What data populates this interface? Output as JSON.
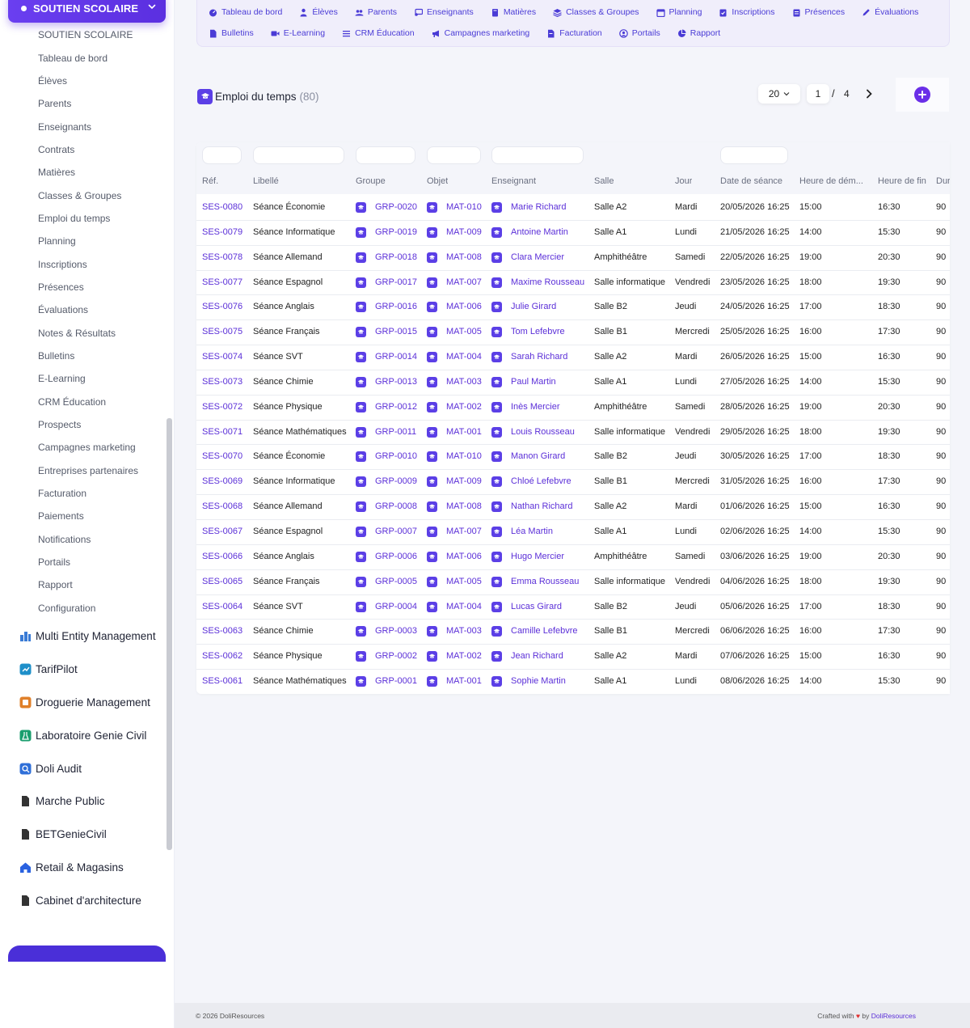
{
  "sidebar": {
    "module_title": "SOUTIEN SCOLAIRE",
    "submenu": [
      "SOUTIEN SCOLAIRE",
      "Tableau de bord",
      "Élèves",
      "Parents",
      "Enseignants",
      "Contrats",
      "Matières",
      "Classes & Groupes",
      "Emploi du temps",
      "Planning",
      "Inscriptions",
      "Présences",
      "Évaluations",
      "Notes & Résultats",
      "Bulletins",
      "E-Learning",
      "CRM Éducation",
      "Prospects",
      "Campagnes marketing",
      "Entreprises partenaires",
      "Facturation",
      "Paiements",
      "Notifications",
      "Portails",
      "Rapport",
      "Configuration"
    ],
    "modules": [
      {
        "label": "Multi Entity Management",
        "icon": "buildings-icon",
        "color": "#3a7bd5"
      },
      {
        "label": "TarifPilot",
        "icon": "tarif-icon",
        "color": "#1e8fc9"
      },
      {
        "label": "Droguerie Management",
        "icon": "droguerie-icon",
        "color": "#e0802a"
      },
      {
        "label": "Laboratoire Genie Civil",
        "icon": "lab-icon",
        "color": "#1a9e6e"
      },
      {
        "label": "Doli Audit",
        "icon": "audit-icon",
        "color": "#2f6fd8"
      },
      {
        "label": "Marche Public",
        "icon": "file-icon",
        "color": "#333333"
      },
      {
        "label": "BETGenieCivil",
        "icon": "file-icon",
        "color": "#333333"
      },
      {
        "label": "Retail & Magasins",
        "icon": "home-icon",
        "color": "#2a62e0"
      },
      {
        "label": "Cabinet d'architecture",
        "icon": "file-icon",
        "color": "#333333"
      }
    ]
  },
  "topnav": {
    "row1": [
      {
        "label": "Tableau de bord",
        "icon": "dashboard-icon"
      },
      {
        "label": "Élèves",
        "icon": "student-icon"
      },
      {
        "label": "Parents",
        "icon": "users-icon"
      },
      {
        "label": "Enseignants",
        "icon": "teacher-icon"
      },
      {
        "label": "Matières",
        "icon": "book-icon"
      },
      {
        "label": "Classes & Groupes",
        "icon": "layers-icon"
      },
      {
        "label": "Planning",
        "icon": "calendar-icon"
      },
      {
        "label": "Inscriptions",
        "icon": "clipboard-check-icon"
      },
      {
        "label": "Présences",
        "icon": "clipboard-icon"
      },
      {
        "label": "Évaluations",
        "icon": "pencil-icon"
      }
    ],
    "row2": [
      {
        "label": "Bulletins",
        "icon": "document-icon"
      },
      {
        "label": "E-Learning",
        "icon": "video-icon"
      },
      {
        "label": "CRM Éducation",
        "icon": "list-icon"
      },
      {
        "label": "Campagnes marketing",
        "icon": "megaphone-icon"
      },
      {
        "label": "Facturation",
        "icon": "invoice-icon"
      },
      {
        "label": "Portails",
        "icon": "user-circle-icon"
      },
      {
        "label": "Rapport",
        "icon": "pie-chart-icon"
      }
    ]
  },
  "page": {
    "title": "Emploi du temps",
    "count": "(80)",
    "page_size": "20",
    "current_page": "1",
    "separator": "/",
    "total_pages": "4"
  },
  "table": {
    "headers": [
      "Réf.",
      "Libellé",
      "Groupe",
      "Objet",
      "Enseignant",
      "Salle",
      "Jour",
      "Date de séance",
      "Heure de dém...",
      "Heure de fin",
      "Dur"
    ],
    "rows": [
      [
        "SES-0080",
        "Séance Économie",
        "GRP-0020",
        "MAT-010",
        "Marie Richard",
        "Salle A2",
        "Mardi",
        "20/05/2026 16:25",
        "15:00",
        "16:30",
        "90"
      ],
      [
        "SES-0079",
        "Séance Informatique",
        "GRP-0019",
        "MAT-009",
        "Antoine Martin",
        "Salle A1",
        "Lundi",
        "21/05/2026 16:25",
        "14:00",
        "15:30",
        "90"
      ],
      [
        "SES-0078",
        "Séance Allemand",
        "GRP-0018",
        "MAT-008",
        "Clara Mercier",
        "Amphithéâtre",
        "Samedi",
        "22/05/2026 16:25",
        "19:00",
        "20:30",
        "90"
      ],
      [
        "SES-0077",
        "Séance Espagnol",
        "GRP-0017",
        "MAT-007",
        "Maxime Rousseau",
        "Salle informatique",
        "Vendredi",
        "23/05/2026 16:25",
        "18:00",
        "19:30",
        "90"
      ],
      [
        "SES-0076",
        "Séance Anglais",
        "GRP-0016",
        "MAT-006",
        "Julie Girard",
        "Salle B2",
        "Jeudi",
        "24/05/2026 16:25",
        "17:00",
        "18:30",
        "90"
      ],
      [
        "SES-0075",
        "Séance Français",
        "GRP-0015",
        "MAT-005",
        "Tom Lefebvre",
        "Salle B1",
        "Mercredi",
        "25/05/2026 16:25",
        "16:00",
        "17:30",
        "90"
      ],
      [
        "SES-0074",
        "Séance SVT",
        "GRP-0014",
        "MAT-004",
        "Sarah Richard",
        "Salle A2",
        "Mardi",
        "26/05/2026 16:25",
        "15:00",
        "16:30",
        "90"
      ],
      [
        "SES-0073",
        "Séance Chimie",
        "GRP-0013",
        "MAT-003",
        "Paul Martin",
        "Salle A1",
        "Lundi",
        "27/05/2026 16:25",
        "14:00",
        "15:30",
        "90"
      ],
      [
        "SES-0072",
        "Séance Physique",
        "GRP-0012",
        "MAT-002",
        "Inès Mercier",
        "Amphithéâtre",
        "Samedi",
        "28/05/2026 16:25",
        "19:00",
        "20:30",
        "90"
      ],
      [
        "SES-0071",
        "Séance Mathématiques",
        "GRP-0011",
        "MAT-001",
        "Louis Rousseau",
        "Salle informatique",
        "Vendredi",
        "29/05/2026 16:25",
        "18:00",
        "19:30",
        "90"
      ],
      [
        "SES-0070",
        "Séance Économie",
        "GRP-0010",
        "MAT-010",
        "Manon Girard",
        "Salle B2",
        "Jeudi",
        "30/05/2026 16:25",
        "17:00",
        "18:30",
        "90"
      ],
      [
        "SES-0069",
        "Séance Informatique",
        "GRP-0009",
        "MAT-009",
        "Chloé Lefebvre",
        "Salle B1",
        "Mercredi",
        "31/05/2026 16:25",
        "16:00",
        "17:30",
        "90"
      ],
      [
        "SES-0068",
        "Séance Allemand",
        "GRP-0008",
        "MAT-008",
        "Nathan Richard",
        "Salle A2",
        "Mardi",
        "01/06/2026 16:25",
        "15:00",
        "16:30",
        "90"
      ],
      [
        "SES-0067",
        "Séance Espagnol",
        "GRP-0007",
        "MAT-007",
        "Léa Martin",
        "Salle A1",
        "Lundi",
        "02/06/2026 16:25",
        "14:00",
        "15:30",
        "90"
      ],
      [
        "SES-0066",
        "Séance Anglais",
        "GRP-0006",
        "MAT-006",
        "Hugo Mercier",
        "Amphithéâtre",
        "Samedi",
        "03/06/2026 16:25",
        "19:00",
        "20:30",
        "90"
      ],
      [
        "SES-0065",
        "Séance Français",
        "GRP-0005",
        "MAT-005",
        "Emma Rousseau",
        "Salle informatique",
        "Vendredi",
        "04/06/2026 16:25",
        "18:00",
        "19:30",
        "90"
      ],
      [
        "SES-0064",
        "Séance SVT",
        "GRP-0004",
        "MAT-004",
        "Lucas Girard",
        "Salle B2",
        "Jeudi",
        "05/06/2026 16:25",
        "17:00",
        "18:30",
        "90"
      ],
      [
        "SES-0063",
        "Séance Chimie",
        "GRP-0003",
        "MAT-003",
        "Camille Lefebvre",
        "Salle B1",
        "Mercredi",
        "06/06/2026 16:25",
        "16:00",
        "17:30",
        "90"
      ],
      [
        "SES-0062",
        "Séance Physique",
        "GRP-0002",
        "MAT-002",
        "Jean Richard",
        "Salle A2",
        "Mardi",
        "07/06/2026 16:25",
        "15:00",
        "16:30",
        "90"
      ],
      [
        "SES-0061",
        "Séance Mathématiques",
        "GRP-0001",
        "MAT-001",
        "Sophie Martin",
        "Salle A1",
        "Lundi",
        "08/06/2026 16:25",
        "14:00",
        "15:30",
        "90"
      ]
    ]
  },
  "footer": {
    "copyright": "© 2026 DoliResources",
    "crafted_prefix": "Crafted with",
    "heart": "♥",
    "crafted_by": "by",
    "brand": "DoliResources"
  },
  "colors": {
    "accent": "#5b2fd8",
    "header_gradient_start": "#6a3ff0",
    "nav_background": "#f0eefb"
  }
}
